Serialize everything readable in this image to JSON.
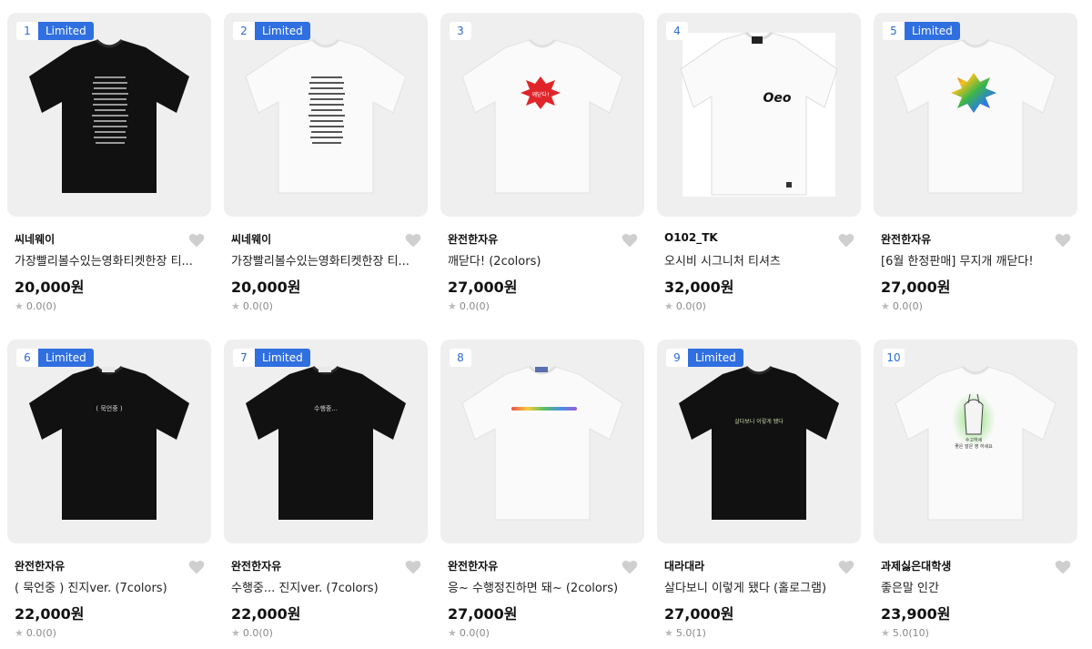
{
  "products": [
    {
      "rank": "1",
      "badge": "Limited",
      "seller": "씨네웨이",
      "title": "가장빨리볼수있는영화티켓한장 티...",
      "price": "20,000원",
      "rating": "0.0(0)",
      "shirt": "black",
      "print": "text-block"
    },
    {
      "rank": "2",
      "badge": "Limited",
      "seller": "씨네웨이",
      "title": "가장빨리볼수있는영화티켓한장 티...",
      "price": "20,000원",
      "rating": "0.0(0)",
      "shirt": "white",
      "print": "text-block"
    },
    {
      "rank": "3",
      "badge": "",
      "seller": "완전한자유",
      "title": "깨닫다! (2colors)",
      "price": "27,000원",
      "rating": "0.0(0)",
      "shirt": "white",
      "print": "red-burst"
    },
    {
      "rank": "4",
      "badge": "",
      "seller": "O102_TK",
      "title": "오시비 시그니처 티셔츠",
      "price": "32,000원",
      "rating": "0.0(0)",
      "shirt": "white",
      "print": "logo"
    },
    {
      "rank": "5",
      "badge": "Limited",
      "seller": "완전한자유",
      "title": "[6월 한정판매] 무지개 깨닫다!",
      "price": "27,000원",
      "rating": "0.0(0)",
      "shirt": "white",
      "print": "rainbow-burst"
    },
    {
      "rank": "6",
      "badge": "Limited",
      "seller": "완전한자유",
      "title": "( 묵언중 ) 진지ver. (7colors)",
      "price": "22,000원",
      "rating": "0.0(0)",
      "shirt": "black",
      "print": "small-text"
    },
    {
      "rank": "7",
      "badge": "Limited",
      "seller": "완전한자유",
      "title": "수행중... 진지ver. (7colors)",
      "price": "22,000원",
      "rating": "0.0(0)",
      "shirt": "black",
      "print": "small-text"
    },
    {
      "rank": "8",
      "badge": "",
      "seller": "완전한자유",
      "title": "응~ 수행정진하면 돼~ (2colors)",
      "price": "27,000원",
      "rating": "0.0(0)",
      "shirt": "white",
      "print": "rainbow-line"
    },
    {
      "rank": "9",
      "badge": "Limited",
      "seller": "대라대라",
      "title": "살다보니 이렇게 됐다 (홀로그램)",
      "price": "27,000원",
      "rating": "5.0(1)",
      "shirt": "black",
      "print": "small-text"
    },
    {
      "rank": "10",
      "badge": "",
      "seller": "과제싫은대학생",
      "title": "좋은말 인간",
      "price": "23,900원",
      "rating": "5.0(10)",
      "shirt": "white",
      "print": "green-figure"
    }
  ],
  "prints": {
    "card6": "( 묵언중 )",
    "card7": "수행중...",
    "card9": "살다보니 이렇게 됐다",
    "card3": "깨닫다!",
    "card4": "Oeo",
    "card10_a": "수고하세",
    "card10_b": "좋은 말은 영 하세요"
  },
  "colors": {
    "badge": "#2f6fe0",
    "rank_text": "#2e6bd6",
    "thumb_bg": "#efefef",
    "heart": "#cfcfcf"
  }
}
